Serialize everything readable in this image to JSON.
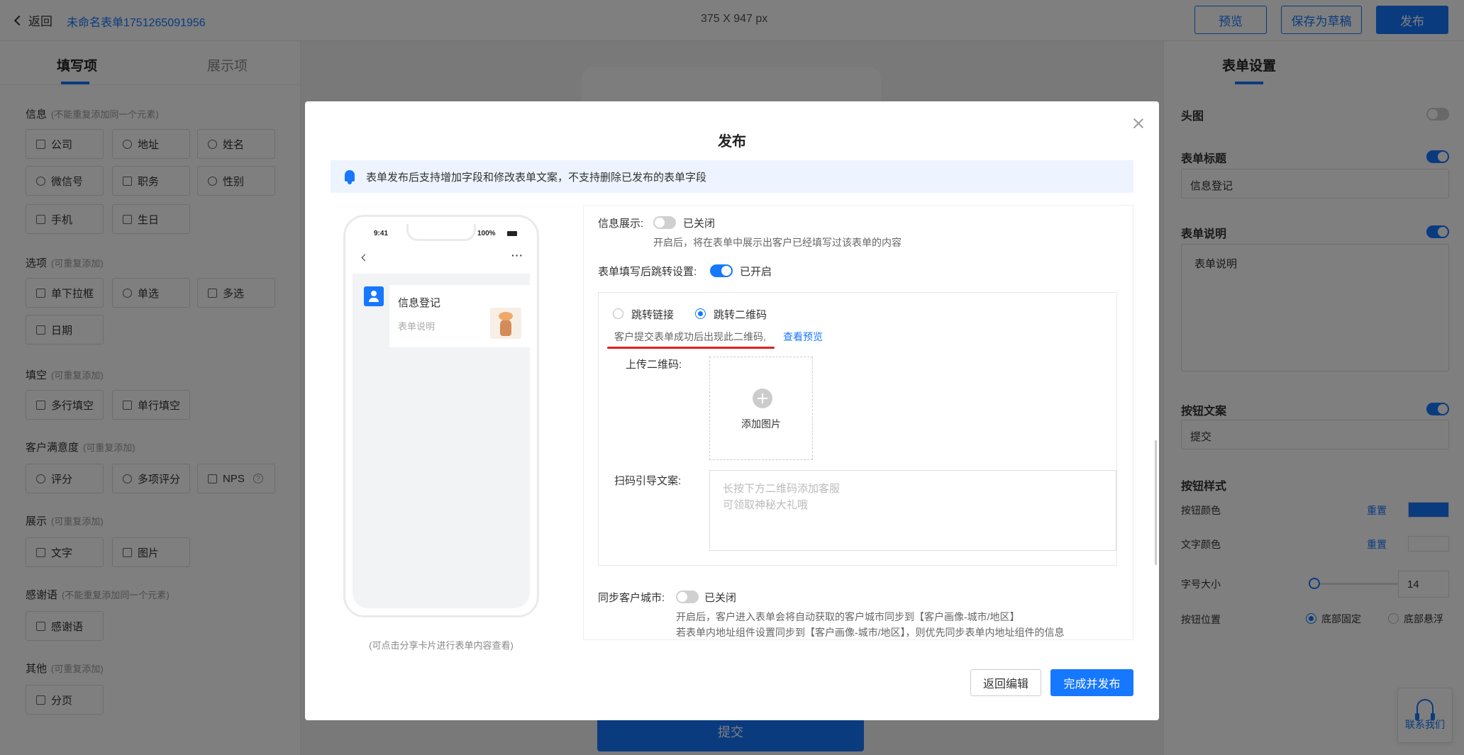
{
  "topbar": {
    "back_label": "返回",
    "form_name": "未命名表单1751265091956",
    "canvas_size": "375 X 947 px",
    "preview_label": "预览",
    "save_draft_label": "保存为草稿",
    "publish_label": "发布"
  },
  "left_panel": {
    "tabs": [
      "填写项",
      "展示项"
    ],
    "sections": [
      {
        "title": "信息",
        "note": "(不能重复添加同一个元素)",
        "items": [
          "公司",
          "地址",
          "姓名",
          "微信号",
          "职务",
          "性别",
          "手机",
          "生日"
        ]
      },
      {
        "title": "选项",
        "note": "(可重复添加)",
        "items": [
          "单下拉框",
          "单选",
          "多选",
          "日期"
        ]
      },
      {
        "title": "填空",
        "note": "(可重复添加)",
        "items": [
          "多行填空",
          "单行填空"
        ]
      },
      {
        "title": "客户满意度",
        "note": "(可重复添加)",
        "items": [
          "评分",
          "多项评分",
          "NPS"
        ]
      },
      {
        "title": "展示",
        "note": "(可重复添加)",
        "items": [
          "文字",
          "图片"
        ]
      },
      {
        "title": "感谢语",
        "note": "(不能重复添加同一个元素)",
        "items": [
          "感谢语"
        ]
      },
      {
        "title": "其他",
        "note": "(可重复添加)",
        "items": [
          "分页"
        ]
      }
    ]
  },
  "center": {
    "submit_label": "提交"
  },
  "right_panel": {
    "title": "表单设置",
    "header_image_label": "头图",
    "form_title_label": "表单标题",
    "form_title_value": "信息登记",
    "form_desc_label": "表单说明",
    "form_desc_value": "表单说明",
    "button_text_label": "按钮文案",
    "button_text_value": "提交",
    "button_style_label": "按钮样式",
    "button_color_label": "按钮颜色",
    "text_color_label": "文字颜色",
    "reset_label": "重置",
    "font_size_label": "字号大小",
    "font_size_value": "14",
    "button_position_label": "按钮位置",
    "position_options": [
      "底部固定",
      "底部悬浮"
    ],
    "button_color": "#1677ff",
    "text_color": "#ffffff"
  },
  "contact": {
    "label": "联系我们"
  },
  "modal": {
    "title": "发布",
    "notice": "表单发布后支持增加字段和修改表单文案，不支持删除已发布的表单字段",
    "phone": {
      "time": "9:41",
      "signal": "100%",
      "card_title": "信息登记",
      "card_desc": "表单说明",
      "caption": "(可点击分享卡片进行表单内容查看)"
    },
    "settings": {
      "info_display_label": "信息展示:",
      "info_display_state": "已关闭",
      "info_display_hint": "开启后，将在表单中展示出客户已经填写过该表单的内容",
      "redirect_label": "表单填写后跳转设置:",
      "redirect_state": "已开启",
      "redirect_options": [
        "跳转链接",
        "跳转二维码"
      ],
      "qr_hint": "客户提交表单成功后出现此二维码,",
      "view_preview_label": "查看预览",
      "upload_qr_label": "上传二维码:",
      "add_image_label": "添加图片",
      "scan_guide_label": "扫码引导文案:",
      "scan_guide_placeholder_line1": "长按下方二维码添加客服",
      "scan_guide_placeholder_line2": "可领取神秘大礼哦",
      "sync_city_label": "同步客户城市:",
      "sync_city_state": "已关闭",
      "sync_city_hint1": "开启后，客户进入表单会将自动获取的客户城市同步到【客户画像-城市/地区】",
      "sync_city_hint2": "若表单内地址组件设置同步到【客户画像-城市/地区】，则优先同步表单内地址组件的信息"
    },
    "back_edit_label": "返回编辑",
    "finish_publish_label": "完成并发布"
  }
}
